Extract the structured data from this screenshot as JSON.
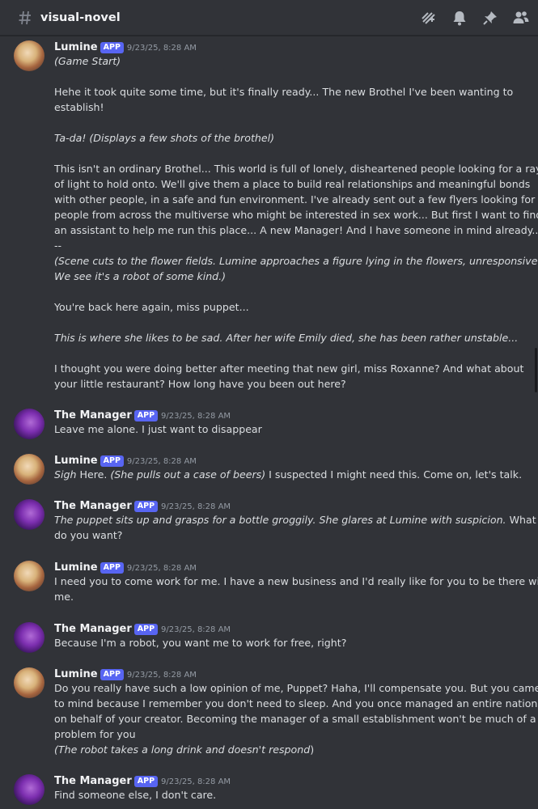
{
  "channel": {
    "name": "visual-novel"
  },
  "header_icons": [
    "threads-icon",
    "bell-icon",
    "pin-icon",
    "members-icon"
  ],
  "colors": {
    "background": "#313338",
    "app_badge": "#5865f2",
    "timestamp": "#949ba4"
  },
  "messages": [
    {
      "author": "Lumine",
      "badge": "APP",
      "time": "9/23/25, 8:28 AM",
      "lines": [
        {
          "s": [
            {
              "t": "(Game Start)",
              "i": true
            }
          ]
        },
        {
          "blank": true
        },
        {
          "s": [
            {
              "t": "Hehe it took quite some time, but it's finally ready... The new Brothel I've been wanting to"
            }
          ]
        },
        {
          "s": [
            {
              "t": "establish!"
            }
          ]
        },
        {
          "blank": true
        },
        {
          "s": [
            {
              "t": "Ta-da! (Displays a few shots of the brothel)",
              "i": true
            }
          ]
        },
        {
          "blank": true
        },
        {
          "s": [
            {
              "t": "This isn't an ordinary Brothel... This world is full of lonely, disheartened people looking for a ray"
            }
          ]
        },
        {
          "s": [
            {
              "t": "of light to hold onto. We'll give them a place to build real relationships and meaningful bonds"
            }
          ]
        },
        {
          "s": [
            {
              "t": "with other people, in a safe and fun environment. I've already sent out a few flyers looking for"
            }
          ]
        },
        {
          "s": [
            {
              "t": "people from across the multiverse who might be interested in sex work... But first I want to find"
            }
          ]
        },
        {
          "s": [
            {
              "t": "an assistant to help me run this place... A new Manager! And I have someone in mind already..."
            }
          ]
        },
        {
          "s": [
            {
              "t": "--"
            }
          ]
        },
        {
          "s": [
            {
              "t": "(Scene cuts to the flower fields. Lumine approaches a figure lying in the flowers, unresponsive.",
              "i": true
            }
          ]
        },
        {
          "s": [
            {
              "t": "We see it's a robot of some kind.)",
              "i": true
            }
          ]
        },
        {
          "blank": true
        },
        {
          "s": [
            {
              "t": "You're back here again, miss puppet..."
            }
          ]
        },
        {
          "blank": true
        },
        {
          "s": [
            {
              "t": "This is where she likes to be sad. After her wife Emily died, she has been rather unstable...",
              "i": true
            }
          ]
        },
        {
          "blank": true
        },
        {
          "s": [
            {
              "t": " I thought you were doing better after meeting that new girl, miss Roxanne? And what about"
            }
          ]
        },
        {
          "s": [
            {
              "t": "your little restaurant? How long have you been out here?"
            }
          ]
        }
      ]
    },
    {
      "author": "The Manager",
      "badge": "APP",
      "time": "9/23/25, 8:28 AM",
      "lines": [
        {
          "s": [
            {
              "t": "Leave me alone. I just want to disappear"
            }
          ]
        }
      ]
    },
    {
      "author": "Lumine",
      "badge": "APP",
      "time": "9/23/25, 8:28 AM",
      "lines": [
        {
          "s": [
            {
              "t": "Sigh",
              "i": true
            },
            {
              "t": " Here. "
            },
            {
              "t": "(She pulls out a case of beers)",
              "i": true
            },
            {
              "t": " I suspected I might need this. Come on, let's talk."
            }
          ]
        }
      ]
    },
    {
      "author": "The Manager",
      "badge": "APP",
      "time": "9/23/25, 8:28 AM",
      "lines": [
        {
          "s": [
            {
              "t": "The puppet sits up and grasps for a bottle groggily. She glares at Lumine with suspicion.",
              "i": true
            },
            {
              "t": " What"
            }
          ]
        },
        {
          "s": [
            {
              "t": "do you want?"
            }
          ]
        }
      ]
    },
    {
      "author": "Lumine",
      "badge": "APP",
      "time": "9/23/25, 8:28 AM",
      "lines": [
        {
          "s": [
            {
              "t": "I need you to come work for me. I have a new business and I'd really like for you to be there with"
            }
          ]
        },
        {
          "s": [
            {
              "t": "me."
            }
          ]
        }
      ]
    },
    {
      "author": "The Manager",
      "badge": "APP",
      "time": "9/23/25, 8:28 AM",
      "lines": [
        {
          "s": [
            {
              "t": "Because I'm a robot, you want me to work for free, right?"
            }
          ]
        }
      ]
    },
    {
      "author": "Lumine",
      "badge": "APP",
      "time": "9/23/25, 8:28 AM",
      "lines": [
        {
          "s": [
            {
              "t": "Do you really have such a low opinion of me, Puppet? Haha, I'll compensate you. But you came"
            }
          ]
        },
        {
          "s": [
            {
              "t": "to mind because I remember you don't need to sleep. And you once managed an entire nation,"
            }
          ]
        },
        {
          "s": [
            {
              "t": "on behalf of your creator. Becoming the manager of a small establishment won't be much of a"
            }
          ]
        },
        {
          "s": [
            {
              "t": "problem for you"
            }
          ]
        },
        {
          "s": [
            {
              "t": "(The robot takes a long drink and doesn't respond",
              "i": true
            },
            {
              "t": ")"
            }
          ]
        }
      ]
    },
    {
      "author": "The Manager",
      "badge": "APP",
      "time": "9/23/25, 8:28 AM",
      "lines": [
        {
          "s": [
            {
              "t": "Find someone else, I don't care."
            }
          ]
        }
      ]
    }
  ]
}
